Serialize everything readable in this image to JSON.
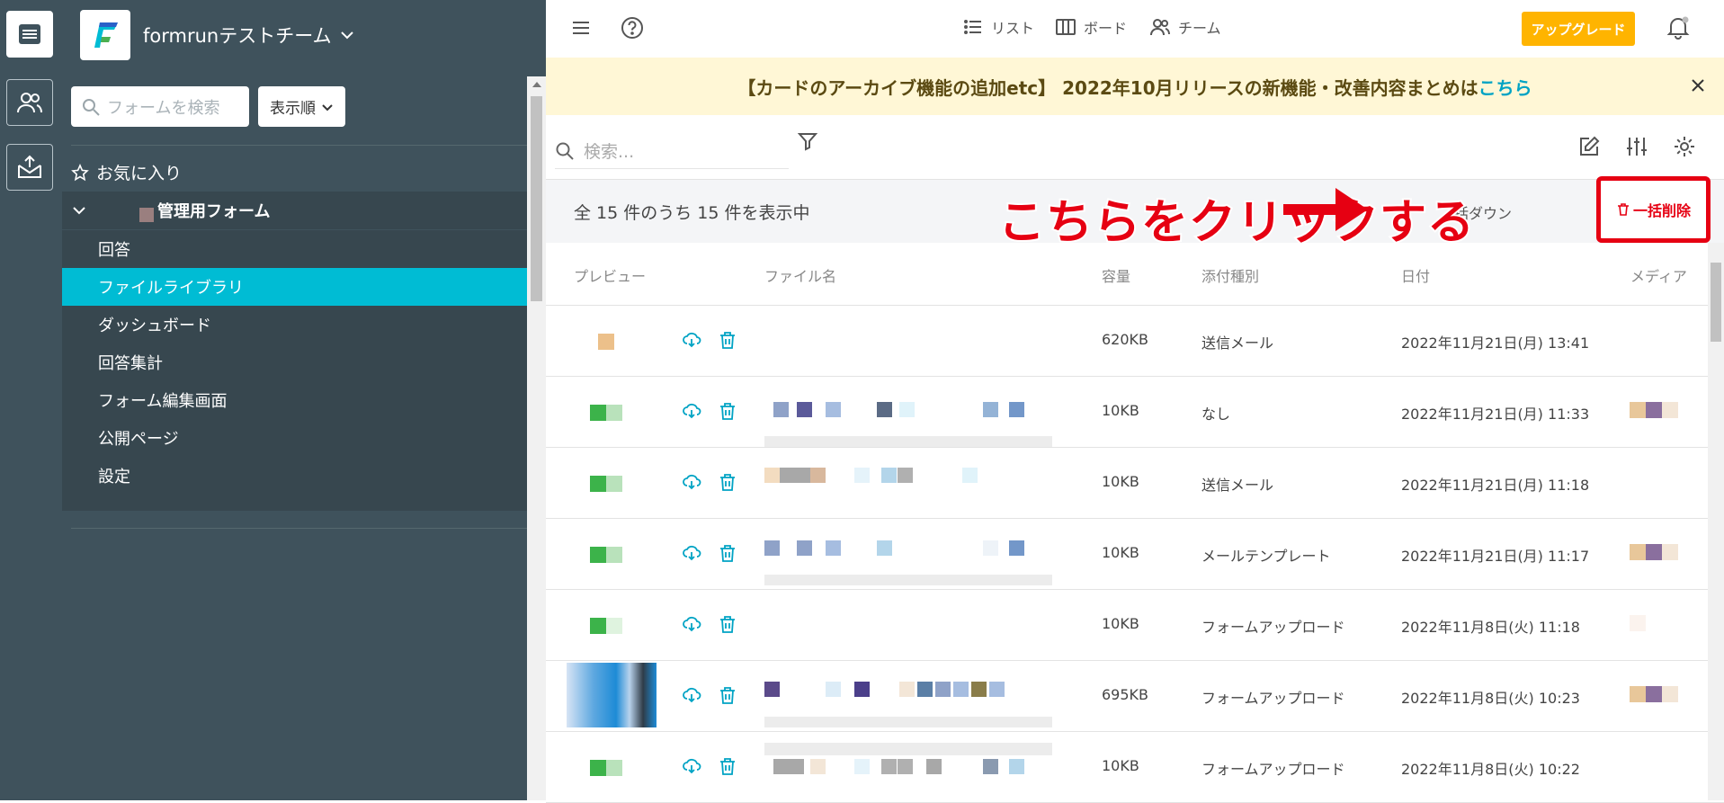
{
  "team": {
    "name": "formrunテストチーム"
  },
  "sidebar": {
    "search_placeholder": "フォームを検索",
    "sort_label": "表示順",
    "favorites_label": "お気に入り",
    "form_name": "管理用フォーム",
    "items": [
      {
        "label": "回答"
      },
      {
        "label": "ファイルライブラリ",
        "selected": true
      },
      {
        "label": "ダッシュボード"
      },
      {
        "label": "回答集計"
      },
      {
        "label": "フォーム編集画面"
      },
      {
        "label": "公開ページ"
      },
      {
        "label": "設定"
      }
    ]
  },
  "topnav": {
    "list_label": "リスト",
    "board_label": "ボード",
    "team_label": "チーム",
    "upgrade_label": "アップグレード"
  },
  "banner": {
    "text": "【カードのアーカイブ機能の追加etc】 2022年10月リリースの新機能・改善内容まとめは",
    "link": "こちら"
  },
  "toolbar": {
    "search_placeholder": "検索..."
  },
  "summary": {
    "count_text": "全 15 件のうち 15 件を表示中",
    "bulk_download_partial": "括ダウン"
  },
  "annotation": {
    "text": "こちらをクリックする"
  },
  "bulk_delete_label": "一括削除",
  "table": {
    "headers": {
      "preview": "プレビュー",
      "filename": "ファイル名",
      "size": "容量",
      "type": "添付種別",
      "date": "日付",
      "media": "メディア"
    },
    "rows": [
      {
        "size": "620KB",
        "type": "送信メール",
        "date": "2022年11月21日(月) 13:41"
      },
      {
        "size": "10KB",
        "type": "なし",
        "date": "2022年11月21日(月) 11:33"
      },
      {
        "size": "10KB",
        "type": "送信メール",
        "date": "2022年11月21日(月) 11:18"
      },
      {
        "size": "10KB",
        "type": "メールテンプレート",
        "date": "2022年11月21日(月) 11:17"
      },
      {
        "size": "10KB",
        "type": "フォームアップロード",
        "date": "2022年11月8日(火) 11:18"
      },
      {
        "size": "695KB",
        "type": "フォームアップロード",
        "date": "2022年11月8日(火) 10:23"
      },
      {
        "size": "10KB",
        "type": "フォームアップロード",
        "date": "2022年11月8日(火) 10:22"
      }
    ]
  },
  "colors": {
    "accent": "#00bcd4",
    "sidebar": "#3f525c",
    "upgrade": "#ffb400",
    "annotation": "#e60012"
  }
}
